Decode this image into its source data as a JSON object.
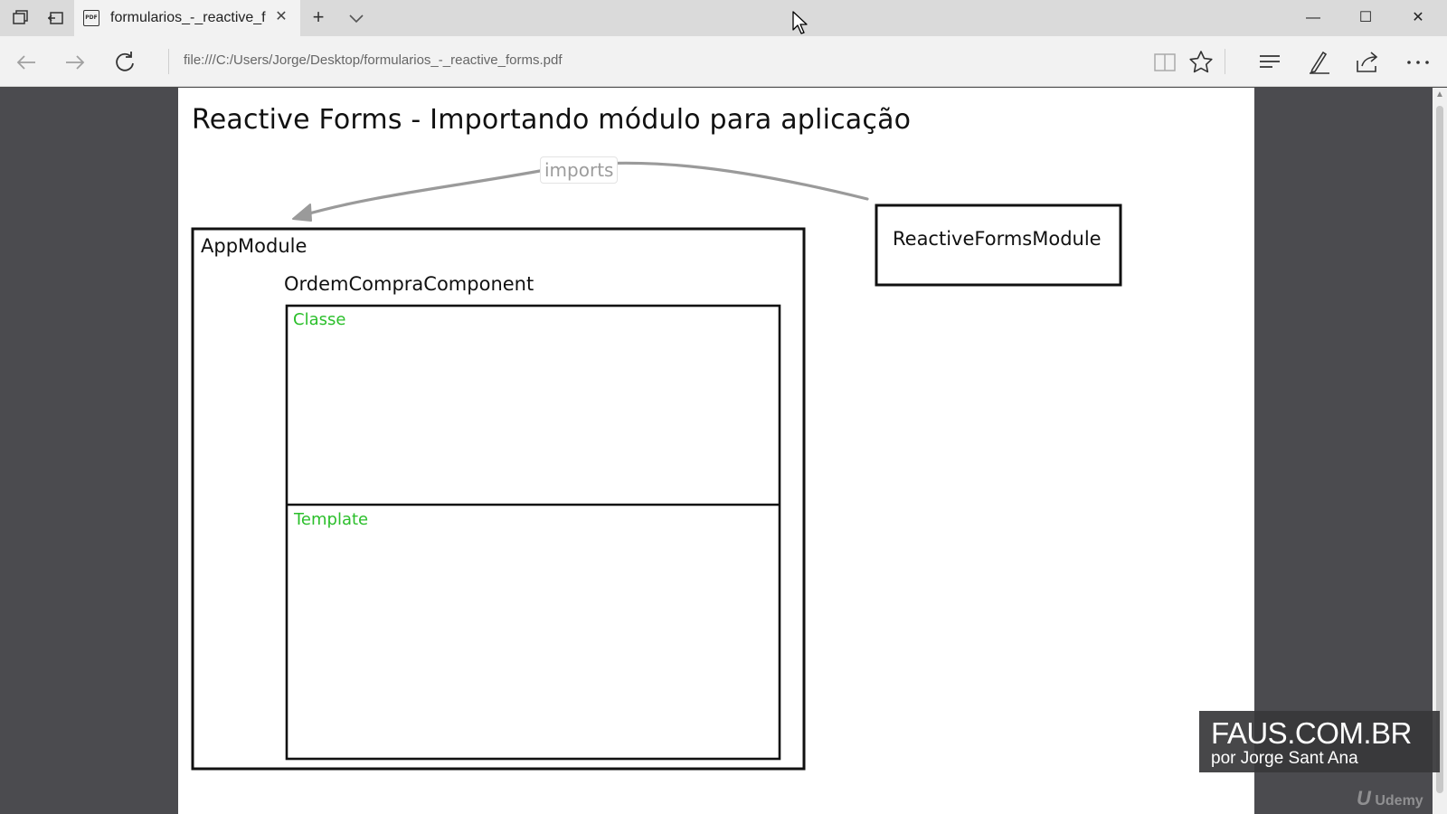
{
  "browser": {
    "tab": {
      "title": "formularios_-_reactive_f",
      "favicon_text": "PDF"
    },
    "address": "file:///C:/Users/Jorge/Desktop/formularios_-_reactive_forms.pdf",
    "icons": {
      "tab_actions": "tab-actions-icon",
      "set_aside": "set-aside-tabs-icon",
      "new_tab": "+",
      "close_tab": "✕",
      "tab_menu": "chevron-down-icon",
      "back": "back-arrow-icon",
      "forward": "forward-arrow-icon",
      "refresh": "refresh-icon",
      "reading_view": "reading-view-icon",
      "favorite": "star-icon",
      "hub": "hub-icon",
      "web_note": "pen-icon",
      "share": "share-icon",
      "more": "more-icon"
    },
    "window_controls": {
      "minimize": "—",
      "maximize": "☐",
      "close": "✕"
    }
  },
  "slide": {
    "title": "Reactive Forms - Importando módulo para aplicação",
    "imports_label": "imports",
    "app_module_label": "AppModule",
    "component_label": "OrdemCompraComponent",
    "classe_label": "Classe",
    "template_label": "Template",
    "reactive_forms_module_label": "ReactiveFormsModule",
    "accent_color": "#2bbf2b"
  },
  "watermark": {
    "title": "FAUS.COM.BR",
    "subtitle": "por Jorge Sant Ana",
    "udemy_mark": "U",
    "udemy_text": "Udemy"
  }
}
